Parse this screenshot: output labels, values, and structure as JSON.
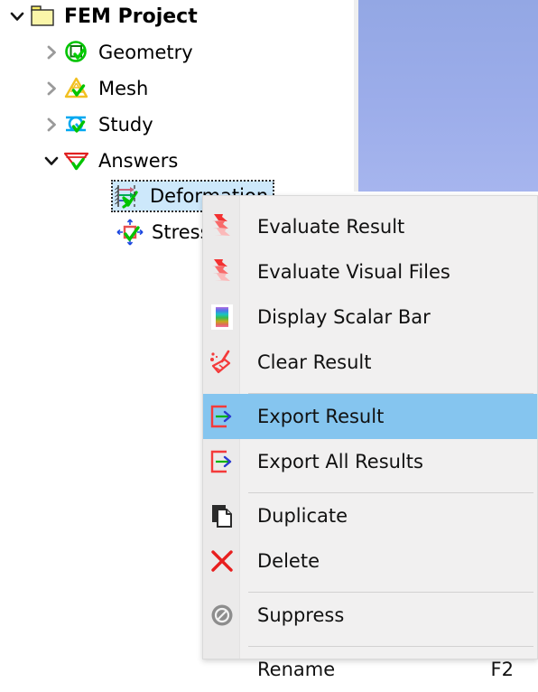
{
  "viewport": {
    "name": "3d-viewport",
    "background_top": "#93a7e4",
    "background_bottom": "#a6b5ee"
  },
  "tree": {
    "root": {
      "label": "FEM Project",
      "icon": "folder-icon",
      "expanded": true
    },
    "items": [
      {
        "label": "Geometry",
        "icon": "geometry-icon",
        "expanded": false,
        "indent": 1
      },
      {
        "label": "Mesh",
        "icon": "mesh-icon",
        "expanded": false,
        "indent": 1
      },
      {
        "label": "Study",
        "icon": "study-icon",
        "expanded": false,
        "indent": 1
      },
      {
        "label": "Answers",
        "icon": "answers-icon",
        "expanded": true,
        "indent": 1
      }
    ],
    "children": [
      {
        "label": "Deformation",
        "icon": "deformation-icon",
        "selected": true,
        "indent": 2
      },
      {
        "label": "Stress",
        "icon": "stress-icon",
        "selected": false,
        "indent": 2
      }
    ],
    "selection_color": "#cde8fb"
  },
  "context_menu": {
    "name": "result-context-menu",
    "highlight_color": "#85c5ef",
    "background": "#f1f0f0",
    "items": [
      {
        "label": "Evaluate Result",
        "icon": "lightning-bolt-icon",
        "accel": "",
        "highlighted": false
      },
      {
        "label": "Evaluate Visual Files",
        "icon": "lightning-bolt-icon",
        "accel": "",
        "highlighted": false
      },
      {
        "label": "Display Scalar Bar",
        "icon": "color-scalar-bar-icon",
        "accel": "",
        "highlighted": false
      },
      {
        "label": "Clear Result",
        "icon": "broom-icon",
        "accel": "",
        "highlighted": false
      },
      {
        "label": "Export Result",
        "icon": "export-arrow-icon",
        "accel": "",
        "highlighted": true
      },
      {
        "label": "Export All Results",
        "icon": "export-arrow-icon",
        "accel": "",
        "highlighted": false
      },
      {
        "label": "Duplicate",
        "icon": "copy-icon",
        "accel": "",
        "highlighted": false
      },
      {
        "label": "Delete",
        "icon": "x-delete-icon",
        "accel": "",
        "highlighted": false
      },
      {
        "label": "Suppress",
        "icon": "no-entry-icon",
        "accel": "",
        "highlighted": false
      },
      {
        "label": "Rename",
        "icon": "",
        "accel": "F2",
        "highlighted": false
      }
    ]
  }
}
